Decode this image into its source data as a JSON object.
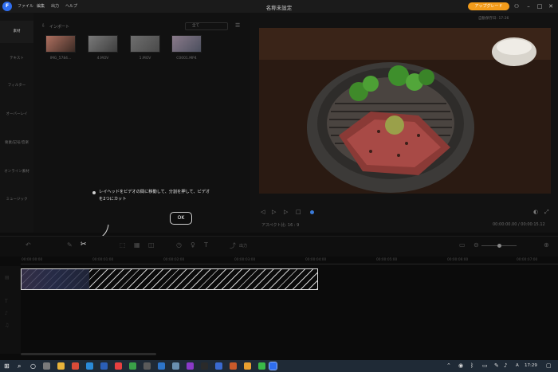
{
  "window": {
    "title": "名称未設定",
    "menu": [
      "ファイル",
      "編集",
      "出力",
      "ヘルプ"
    ],
    "upgrade_label": "アップグレード"
  },
  "sidebar": {
    "items": [
      {
        "label": "素材"
      },
      {
        "label": "テキスト"
      },
      {
        "label": "フィルター"
      },
      {
        "label": "オーバーレイ"
      },
      {
        "label": "要素/記号/音楽"
      },
      {
        "label": "オンライン素材"
      },
      {
        "label": "ミュージック"
      }
    ]
  },
  "media": {
    "import_label": "インポート",
    "filter_value": "全て",
    "items": [
      {
        "name": "IMG_5784..."
      },
      {
        "name": "4.MOV"
      },
      {
        "name": "1.MOV"
      },
      {
        "name": "C0001.MP4"
      }
    ]
  },
  "preview": {
    "caption": "自動保存日:  17:26",
    "aspect_label": "アスペクト比:  16 : 9",
    "timecode": "00:00:00.00 / 00:00:15.12"
  },
  "tutorial": {
    "text": "レイヘッドをビデオの間に移動して、分割を押して、ビデオを2つにカット",
    "ok_label": "OK"
  },
  "toolbar": {
    "export_label": "出力"
  },
  "timeline": {
    "ticks": [
      "00:00:00:00",
      "00:00:01:00",
      "00:00:02:00",
      "00:00:03:00",
      "00:00:04:00",
      "00:00:05:00",
      "00:00:06:00",
      "00:00:07:00",
      "00:00:08:00"
    ]
  },
  "taskbar": {
    "time": "17:29",
    "ime": "A"
  },
  "colors": {
    "accent": "#f29b1a",
    "logo": "#2f6ef0",
    "background": "#0d0d0d"
  }
}
